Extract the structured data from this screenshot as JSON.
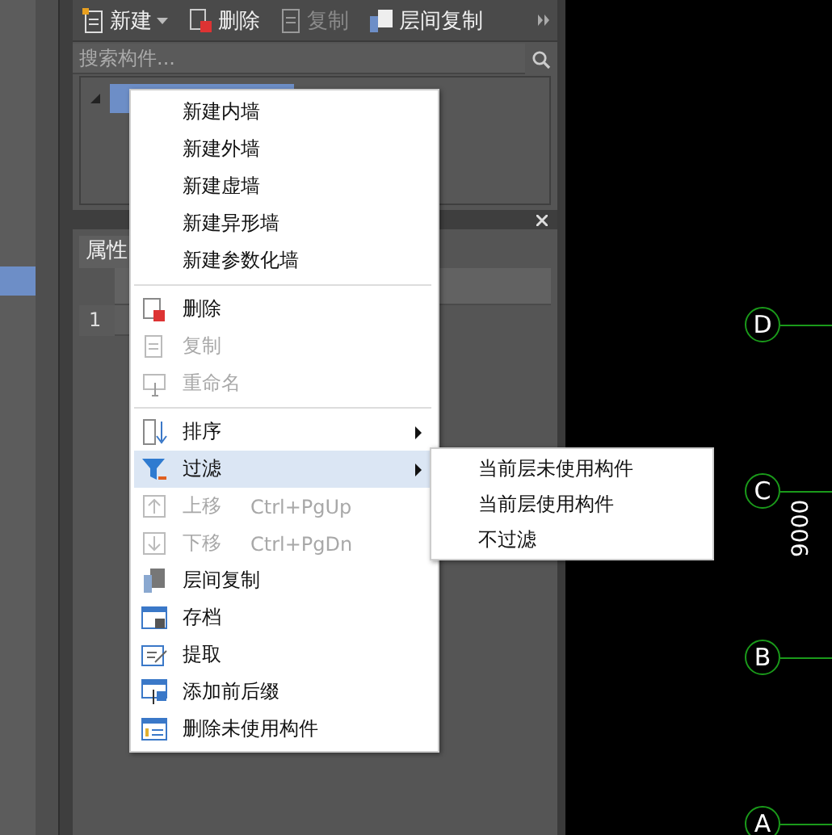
{
  "toolbar": {
    "buttons": [
      {
        "label": "新建",
        "disabled": false,
        "dropdown": true
      },
      {
        "label": "删除",
        "disabled": false,
        "dropdown": false
      },
      {
        "label": "复制",
        "disabled": true,
        "dropdown": false
      },
      {
        "label": "层间复制",
        "disabled": false,
        "dropdown": false
      }
    ]
  },
  "search": {
    "placeholder": "搜索构件..."
  },
  "tree": {
    "items": [
      {
        "expanded": true,
        "selected": true
      }
    ]
  },
  "properties": {
    "tab": "属性",
    "rows": [
      {
        "number": "1"
      }
    ]
  },
  "context_menu": {
    "items": [
      {
        "kind": "item",
        "label": "新建内墙",
        "disabled": false,
        "selected": false,
        "submenu": false
      },
      {
        "kind": "item",
        "label": "新建外墙",
        "disabled": false,
        "selected": false,
        "submenu": false
      },
      {
        "kind": "item",
        "label": "新建虚墙",
        "disabled": false,
        "selected": false,
        "submenu": false
      },
      {
        "kind": "item",
        "label": "新建异形墙",
        "disabled": false,
        "selected": false,
        "submenu": false
      },
      {
        "kind": "item",
        "label": "新建参数化墙",
        "disabled": false,
        "selected": false,
        "submenu": false
      },
      {
        "kind": "separator"
      },
      {
        "kind": "item",
        "label": "删除",
        "disabled": false,
        "selected": false,
        "submenu": false
      },
      {
        "kind": "item",
        "label": "复制",
        "disabled": true,
        "selected": false,
        "submenu": false
      },
      {
        "kind": "item",
        "label": "重命名",
        "disabled": true,
        "selected": false,
        "submenu": false
      },
      {
        "kind": "separator"
      },
      {
        "kind": "item",
        "label": "排序",
        "disabled": false,
        "selected": false,
        "submenu": true
      },
      {
        "kind": "item",
        "label": "过滤",
        "disabled": false,
        "selected": true,
        "submenu": true
      },
      {
        "kind": "item",
        "label": "上移",
        "shortcut": "Ctrl+PgUp",
        "disabled": true,
        "selected": false,
        "submenu": false
      },
      {
        "kind": "item",
        "label": "下移",
        "shortcut": "Ctrl+PgDn",
        "disabled": true,
        "selected": false,
        "submenu": false
      },
      {
        "kind": "item",
        "label": "层间复制",
        "disabled": false,
        "selected": false,
        "submenu": false
      },
      {
        "kind": "item",
        "label": "存档",
        "disabled": false,
        "selected": false,
        "submenu": false
      },
      {
        "kind": "item",
        "label": "提取",
        "disabled": false,
        "selected": false,
        "submenu": false
      },
      {
        "kind": "item",
        "label": "添加前后缀",
        "disabled": false,
        "selected": false,
        "submenu": false
      },
      {
        "kind": "item",
        "label": "删除未使用构件",
        "disabled": false,
        "selected": false,
        "submenu": false
      }
    ]
  },
  "submenu": {
    "items": [
      "当前层未使用构件",
      "当前层使用构件",
      "不过滤"
    ]
  },
  "canvas": {
    "axes": [
      "D",
      "C",
      "B",
      "A"
    ],
    "dimension": "9000"
  }
}
